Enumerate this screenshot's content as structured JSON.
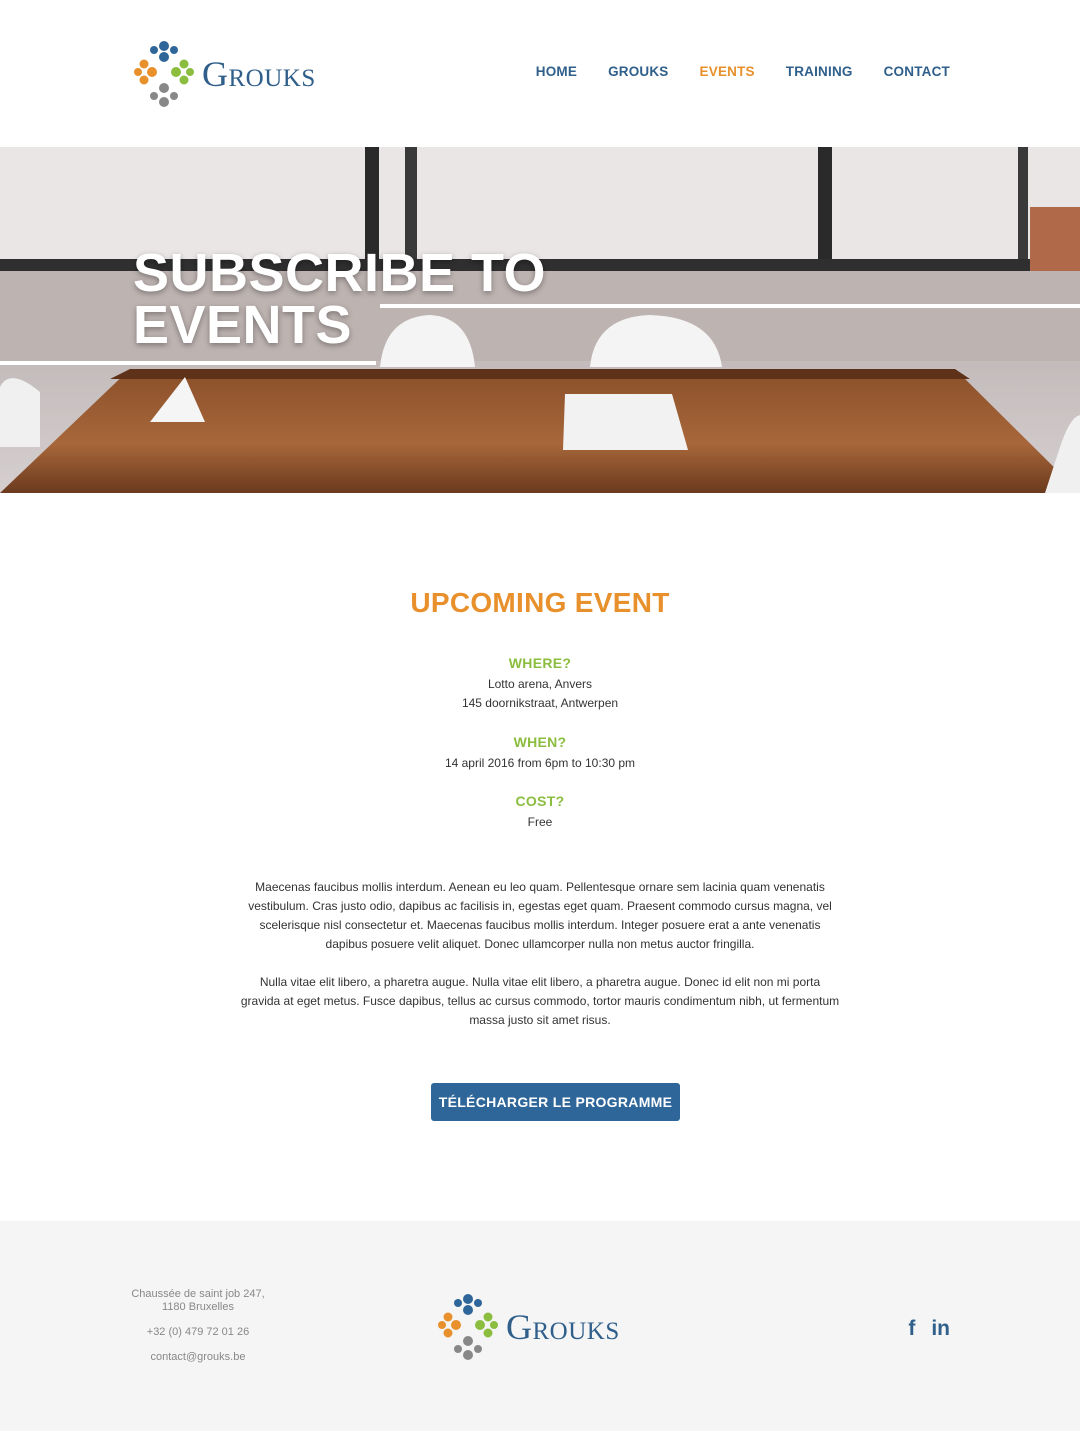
{
  "brand": {
    "name": "Grouks",
    "primary_color": "#2f5f8a",
    "accent_color": "#e8902c",
    "green_color": "#8bbd3f"
  },
  "nav": [
    {
      "label": "HOME",
      "active": false
    },
    {
      "label": "GROUKS",
      "active": false
    },
    {
      "label": "EVENTS",
      "active": true
    },
    {
      "label": "TRAINING",
      "active": false
    },
    {
      "label": "CONTACT",
      "active": false
    }
  ],
  "hero": {
    "title_line1": "SUBSCRIBE TO",
    "title_line2": "EVENTS"
  },
  "event": {
    "title": "UPCOMING EVENT",
    "where_label": "WHERE?",
    "where_line1": "Lotto arena, Anvers",
    "where_line2": "145 doornikstraat, Antwerpen",
    "when_label": "WHEN?",
    "when_value": "14 april 2016 from 6pm to 10:30 pm",
    "cost_label": "COST?",
    "cost_value": "Free",
    "paragraph1": "Maecenas faucibus mollis interdum. Aenean eu leo quam. Pellentesque ornare sem lacinia quam venenatis vestibulum. Cras justo odio, dapibus ac facilisis in, egestas eget quam. Praesent commodo cursus magna, vel scelerisque nisl consectetur et. Maecenas faucibus mollis interdum. Integer posuere erat a ante venenatis dapibus posuere velit aliquet. Donec ullamcorper nulla non metus auctor fringilla.",
    "paragraph2": "Nulla vitae elit libero, a pharetra augue. Nulla vitae elit libero, a pharetra augue. Donec id elit non mi porta gravida at eget metus. Fusce dapibus, tellus ac cursus commodo, tortor mauris condimentum nibh, ut fermentum massa justo sit amet risus.",
    "button_label": "TÉLÉCHARGER LE PROGRAMME"
  },
  "footer": {
    "address_line1": "Chaussée de saint job 247,",
    "address_line2": "1180 Bruxelles",
    "phone": "+32 (0) 479 72 01 26",
    "email": "contact@grouks.be",
    "social": {
      "facebook": "f",
      "linkedin": "in"
    }
  }
}
